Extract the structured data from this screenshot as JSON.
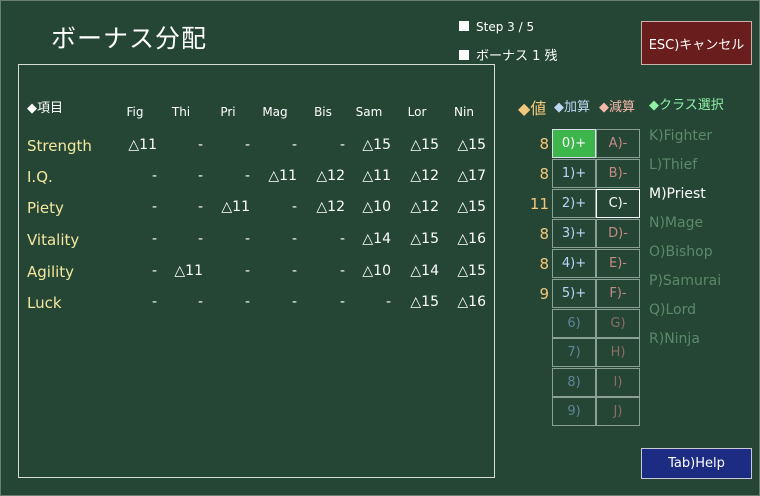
{
  "title": "ボーナス分配",
  "step_text": "Step 3 / 5",
  "remaining_text": "ボーナス 1 残",
  "esc_label": "ESC)キャンセル",
  "help_label": "Tab)Help",
  "table": {
    "item_header": "◆項目",
    "class_headers": [
      "Fig",
      "Thi",
      "Pri",
      "Mag",
      "Bis",
      "Sam",
      "Lor",
      "Nin"
    ],
    "rows": [
      {
        "stat": "Strength",
        "cells": [
          "△11",
          "-",
          "-",
          "-",
          "-",
          "△15",
          "△15",
          "△15"
        ]
      },
      {
        "stat": "I.Q.",
        "cells": [
          "-",
          "-",
          "-",
          "△11",
          "△12",
          "△11",
          "△12",
          "△17"
        ]
      },
      {
        "stat": "Piety",
        "cells": [
          "-",
          "-",
          "△11",
          "-",
          "△12",
          "△10",
          "△12",
          "△15"
        ]
      },
      {
        "stat": "Vitality",
        "cells": [
          "-",
          "-",
          "-",
          "-",
          "-",
          "△14",
          "△15",
          "△16"
        ]
      },
      {
        "stat": "Agility",
        "cells": [
          "-",
          "△11",
          "-",
          "-",
          "-",
          "△10",
          "△14",
          "△15"
        ]
      },
      {
        "stat": "Luck",
        "cells": [
          "-",
          "-",
          "-",
          "-",
          "-",
          "-",
          "△15",
          "△16"
        ]
      }
    ]
  },
  "legend": {
    "value": "◆値",
    "add": "◆加算",
    "sub": "◆減算",
    "class_select": "◆クラス選択"
  },
  "values": [
    "8",
    "8",
    "11",
    "8",
    "8",
    "9"
  ],
  "add_buttons": [
    "0)+",
    "1)+",
    "2)+",
    "3)+",
    "4)+",
    "5)+",
    "6)",
    "7)",
    "8)",
    "9)"
  ],
  "sub_buttons": [
    "A)-",
    "B)-",
    "C)-",
    "D)-",
    "E)-",
    "F)-",
    "G)",
    "H)",
    "I)",
    "J)"
  ],
  "classes": [
    "K)Fighter",
    "L)Thief",
    "M)Priest",
    "N)Mage",
    "O)Bishop",
    "P)Samurai",
    "Q)Lord",
    "R)Ninja"
  ],
  "selected_class": "M)Priest",
  "colors": {
    "background": "#254535",
    "stat_text": "#f2e8a0",
    "value_text": "#f2c87a",
    "active_add": "#3cb54a",
    "esc_button": "#6a1d1d",
    "help_button": "#1c2c82"
  }
}
